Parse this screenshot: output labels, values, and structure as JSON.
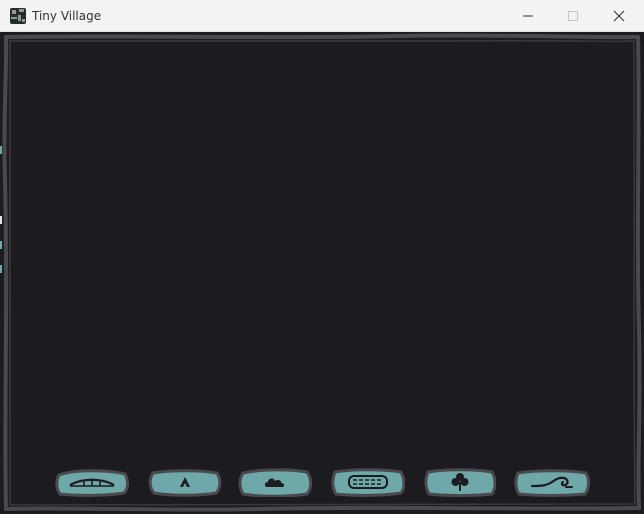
{
  "window": {
    "title": "Tiny Village",
    "icons": {
      "app": "tiny-village-app-icon",
      "minimize": "minimize-icon",
      "maximize": "maximize-icon",
      "close": "close-icon"
    }
  },
  "game": {
    "background_color": "#1c1b20",
    "frame_color": "#4a4a4e",
    "button_fill_color": "#6fa8a8",
    "glyph_color": "#1c1b20",
    "toolbar": [
      {
        "id": "bridge",
        "icon": "bridge-icon"
      },
      {
        "id": "tent",
        "icon": "tent-icon"
      },
      {
        "id": "cloud",
        "icon": "cloud-icon"
      },
      {
        "id": "fence",
        "icon": "fence-icon"
      },
      {
        "id": "tree",
        "icon": "tree-icon"
      },
      {
        "id": "wave",
        "icon": "wave-icon"
      }
    ]
  }
}
